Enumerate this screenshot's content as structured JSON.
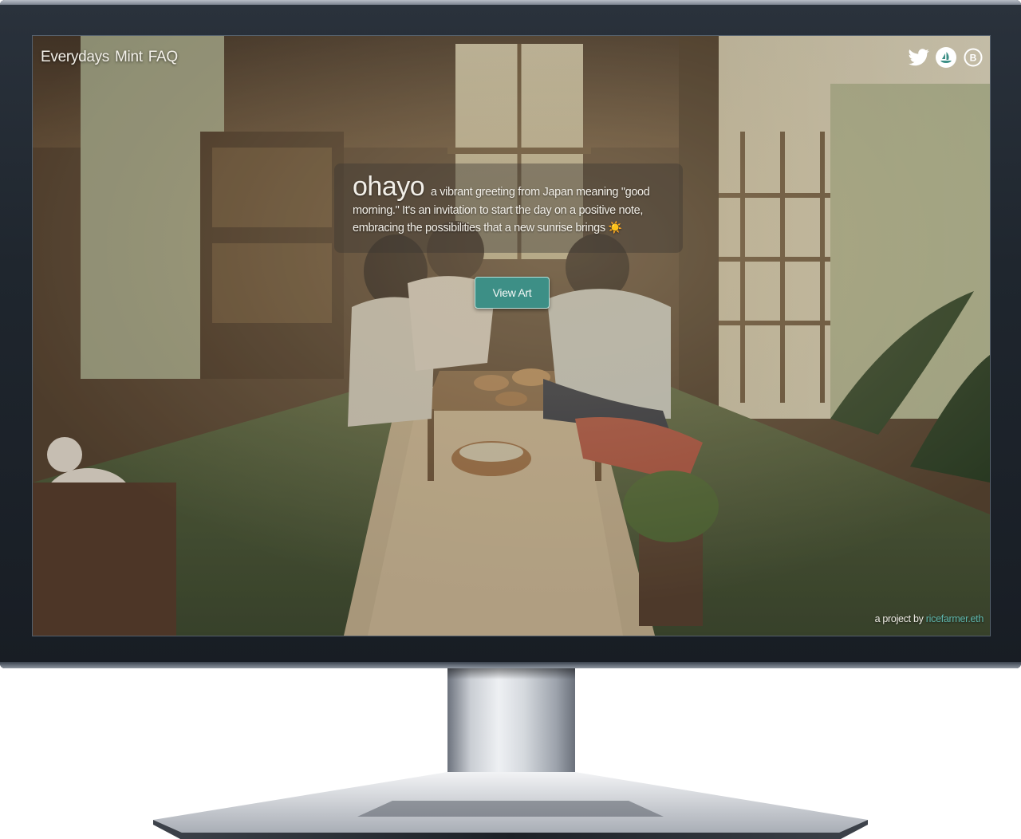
{
  "nav": {
    "items": [
      {
        "label": "Everydays"
      },
      {
        "label": "Mint"
      },
      {
        "label": "FAQ"
      }
    ]
  },
  "social": {
    "icons": [
      "twitter-icon",
      "opensea-icon",
      "coin-icon"
    ],
    "coin_glyph": "B"
  },
  "hero": {
    "word": "ohayo",
    "description": "a vibrant greeting from Japan meaning \"good morning.\" It's an invitation to start the day on a positive note, embracing the possibilities that a new sunrise brings ☀️"
  },
  "cta": {
    "label": "View Art"
  },
  "footer": {
    "prefix": "a project by ",
    "author": "ricefarmer.eth"
  },
  "colors": {
    "accent": "#3d8f86",
    "link": "#5fb7ad",
    "bezel": "#1f262e"
  }
}
